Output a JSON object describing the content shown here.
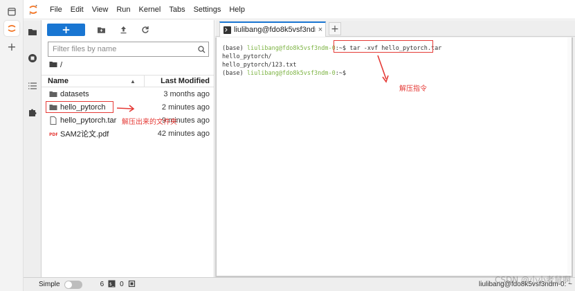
{
  "app": {
    "menu": [
      "File",
      "Edit",
      "View",
      "Run",
      "Kernel",
      "Tabs",
      "Settings",
      "Help"
    ]
  },
  "filebrowser": {
    "new_label": "+",
    "filter_placeholder": "Filter files by name",
    "breadcrumb": "/",
    "columns": {
      "name": "Name",
      "modified": "Last Modified"
    },
    "files": [
      {
        "name": "datasets",
        "modified": "3 months ago",
        "type": "folder"
      },
      {
        "name": "hello_pytorch",
        "modified": "2 minutes ago",
        "type": "folder"
      },
      {
        "name": "hello_pytorch.tar",
        "modified": "9 minutes ago",
        "type": "file"
      },
      {
        "name": "SAM2论文.pdf",
        "modified": "42 minutes ago",
        "type": "pdf"
      }
    ]
  },
  "tabs": [
    {
      "label": "liulibang@fdo8k5vsf3ndm-0: ~",
      "close": "×"
    }
  ],
  "add_tab": "+",
  "terminal": {
    "line1_prefix": "(base) ",
    "line1_user": "liulibang@fdo8k5vsf3ndm-0",
    "line1_path": ":~$ ",
    "line1_cmd": "tar -xvf hello_pytorch.tar",
    "line2": "hello_pytorch/",
    "line3": "hello_pytorch/123.txt",
    "line4_prefix": "(base) ",
    "line4_user": "liulibang@fdo8k5vsf3ndm-0",
    "line4_path": ":~$"
  },
  "annotations": {
    "cmd_label": "解压指令",
    "folder_label": "解压出来的文件夹"
  },
  "statusbar": {
    "simple_label": "Simple",
    "count1": "6",
    "count2": "0",
    "right_text": "liulibang@fdo8k5vsf3ndm-0: ~"
  },
  "watermark": "CSDN @小小老鼠啊",
  "colors": {
    "accent": "#1976d2",
    "annotation": "#e53935",
    "prompt": "#7cb342"
  }
}
